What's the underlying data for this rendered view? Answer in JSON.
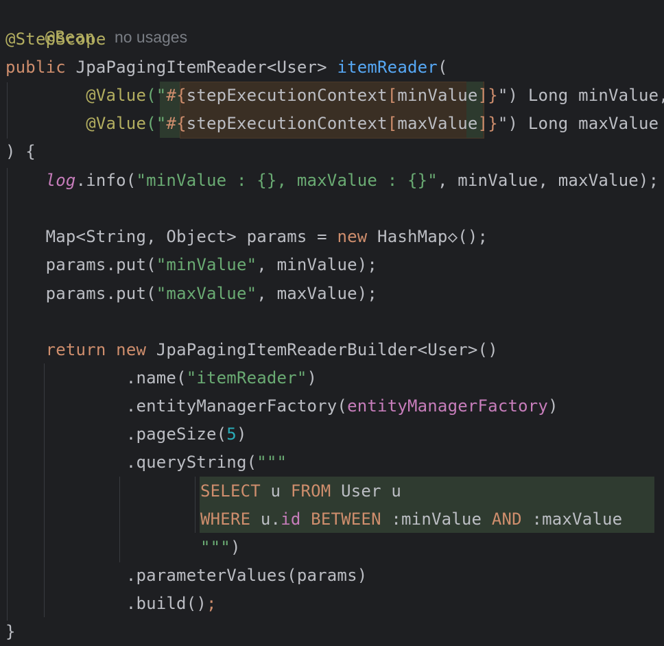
{
  "editor": {
    "hint": {
      "annotation": "@Bean",
      "usages": "no usages"
    },
    "lines": {
      "l2_annotation": "@StepScope",
      "l3_public": "public",
      "l3_type": " JpaPagingItemReader<User> ",
      "l3_method": "itemReader",
      "l3_paren": "(",
      "l4_ann": "@Value",
      "l4_open": "(\"",
      "l4_hash": "#{",
      "l4_ctx": "stepExecutionContext",
      "l4_lb": "[",
      "l4_key": "minValue",
      "l4_rb": "]}",
      "l4_close": "\") Long minValue,",
      "l5_ann": "@Value",
      "l5_open": "(\"",
      "l5_hash": "#{",
      "l5_ctx": "stepExecutionContext",
      "l5_lb": "[",
      "l5_key": "maxValue",
      "l5_rb": "]}",
      "l5_close": "\") Long maxValue",
      "l6": ") {",
      "l7_log": "log",
      "l7_info": ".info(",
      "l7_str": "\"minValue : {}, maxValue : {}\"",
      "l7_rest": ", minValue, maxValue);",
      "l9_decl": "Map<String, Object> params = ",
      "l9_new": "new",
      "l9_rest": " HashMap◇();",
      "l10_pre": "params.put(",
      "l10_str": "\"minValue\"",
      "l10_rest": ", minValue);",
      "l11_pre": "params.put(",
      "l11_str": "\"maxValue\"",
      "l11_rest": ", maxValue);",
      "l13_return": "return",
      "l13_new": "new",
      "l13_rest": " JpaPagingItemReaderBuilder<User>()",
      "l14_pre": ".name(",
      "l14_str": "\"itemReader\"",
      "l14_rest": ")",
      "l15_pre": ".entityManagerFactory(",
      "l15_field": "entityManagerFactory",
      "l15_rest": ")",
      "l16_pre": ".pageSize(",
      "l16_num": "5",
      "l16_rest": ")",
      "l17_pre": ".queryString(",
      "l17_str": "\"\"\"",
      "l18_select": "SELECT",
      "l18_u": " u ",
      "l18_from": "FROM",
      "l18_rest": " User u",
      "l19_where": "WHERE",
      "l19_u": " u.",
      "l19_id": "id",
      "l19_sp": " ",
      "l19_between": "BETWEEN",
      "l19_min": " :minValue ",
      "l19_and": "AND",
      "l19_max": " :maxValue",
      "l20_str": "\"\"\"",
      "l20_rest": ")",
      "l21": ".parameterValues(params)",
      "l22_pre": ".build()",
      "l22_semi": ";",
      "l23": "}"
    }
  },
  "colors": {
    "background": "#1e1f22",
    "annotation": "#b3ae60",
    "keyword": "#cf8e6d",
    "string": "#6aab73",
    "field": "#c77dbb",
    "number": "#2aacb8",
    "text": "#bcbec4",
    "comment": "#7a7e85"
  }
}
